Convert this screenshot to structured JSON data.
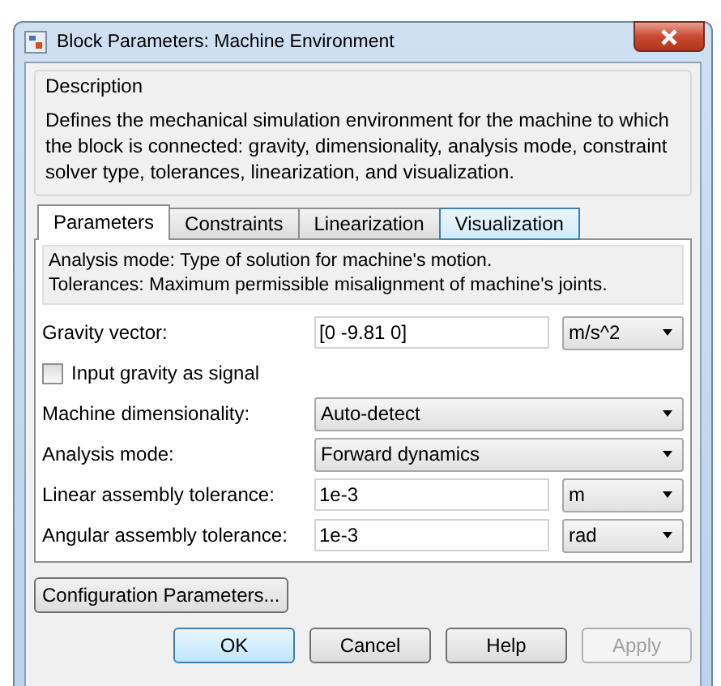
{
  "window": {
    "title": "Block Parameters: Machine Environment"
  },
  "description": {
    "heading": "Description",
    "text": "Defines the mechanical simulation environment for the machine to which the block is connected: gravity, dimensionality, analysis mode, constraint solver type, tolerances, linearization, and visualization."
  },
  "tabs": [
    {
      "label": "Parameters",
      "selected": true,
      "hovered": false
    },
    {
      "label": "Constraints",
      "selected": false,
      "hovered": false
    },
    {
      "label": "Linearization",
      "selected": false,
      "hovered": false
    },
    {
      "label": "Visualization",
      "selected": false,
      "hovered": true
    }
  ],
  "help_text": [
    "Analysis mode: Type of solution for machine's motion.",
    "Tolerances: Maximum permissible misalignment of machine's joints."
  ],
  "parameters": [
    {
      "kind": "value_unit",
      "label": "Gravity vector:",
      "value": "[0 -9.81 0]",
      "unit": "m/s^2"
    },
    {
      "kind": "checkbox",
      "label": "Input gravity as signal",
      "checked": false
    },
    {
      "kind": "select",
      "label": "Machine dimensionality:",
      "value": "Auto-detect"
    },
    {
      "kind": "select",
      "label": "Analysis mode:",
      "value": "Forward dynamics"
    },
    {
      "kind": "value_unit",
      "label": "Linear assembly tolerance:",
      "value": "1e-3",
      "unit": "m"
    },
    {
      "kind": "value_unit",
      "label": "Angular assembly tolerance:",
      "value": "1e-3",
      "unit": "rad"
    }
  ],
  "config_button": "Configuration Parameters...",
  "buttons": [
    {
      "label": "OK",
      "default": true,
      "disabled": false
    },
    {
      "label": "Cancel",
      "default": false,
      "disabled": false
    },
    {
      "label": "Help",
      "default": false,
      "disabled": false
    },
    {
      "label": "Apply",
      "default": false,
      "disabled": true
    }
  ]
}
